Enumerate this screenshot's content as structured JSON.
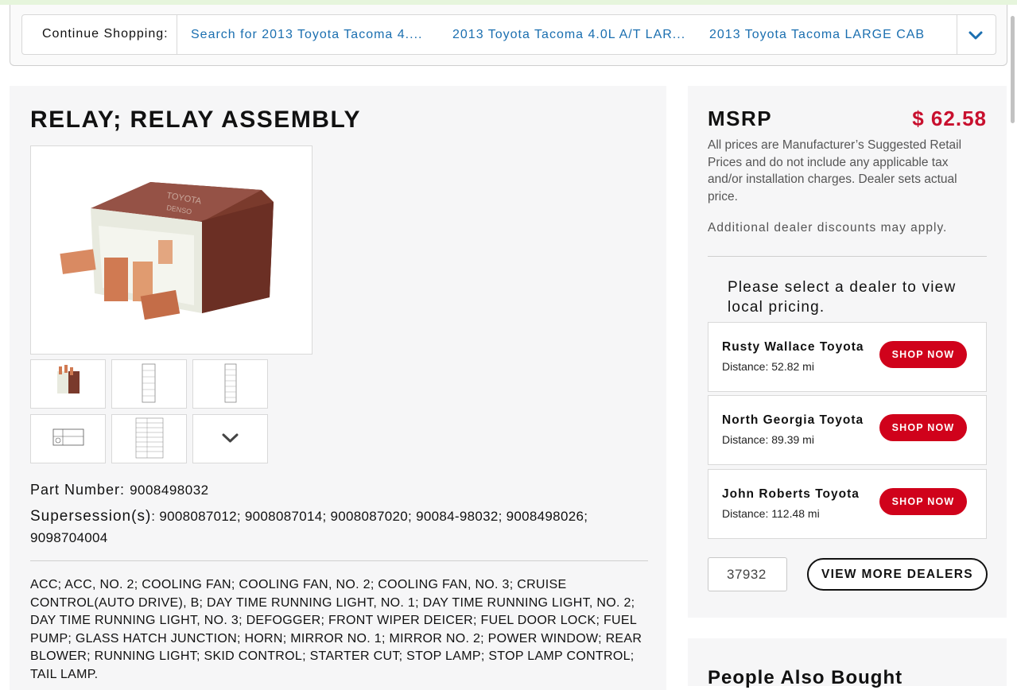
{
  "continue_shopping": {
    "label": "Continue Shopping:",
    "links": [
      "Search for 2013 Toyota Tacoma 4....",
      "2013 Toyota Tacoma 4.0L A/T LAR...",
      "2013 Toyota Tacoma LARGE CAB"
    ],
    "expand_icon": "chevron-down-icon"
  },
  "product": {
    "title": "RELAY; RELAY ASSEMBLY",
    "image_icon": "relay-photo",
    "thumbnails": [
      "relay-photo-thumb",
      "diagram-thumb",
      "diagram-thumb",
      "pnc-table-thumb",
      "parts-list-thumb"
    ],
    "more_thumbs_icon": "chevron-down-icon",
    "part_number_label": "Part Number:",
    "part_number": "9008498032",
    "supersession_label": "Supersession(s)",
    "supersessions": ": 9008087012; 9008087014; 9008087020; 90084-98032; 9008498026; 9098704004",
    "description": "ACC; ACC, NO. 2; COOLING FAN; COOLING FAN, NO. 2; COOLING FAN, NO. 3; CRUISE CONTROL(AUTO DRIVE), B; DAY TIME RUNNING LIGHT, NO. 1; DAY TIME RUNNING LIGHT, NO. 2; DAY TIME RUNNING LIGHT, NO. 3; DEFOGGER; FRONT WIPER DEICER; FUEL DOOR LOCK; FUEL PUMP; GLASS HATCH JUNCTION; HORN; MIRROR NO. 1; MIRROR NO. 2; POWER WINDOW; REAR BLOWER; RUNNING LIGHT; SKID CONTROL; STARTER CUT; STOP LAMP; STOP LAMP CONTROL; TAIL LAMP."
  },
  "pricing": {
    "msrp_label": "MSRP",
    "price": "$ 62.58",
    "price_color": "#c8102e",
    "note": "All prices are Manufacturer’s Suggested Retail Prices and do not include any applicable tax and/or installation charges. Dealer sets actual price.",
    "discount_note": "Additional dealer discounts may apply."
  },
  "dealers": {
    "prompt": "Please select a dealer to view local pricing.",
    "list": [
      {
        "name": "Rusty Wallace Toyota",
        "distance": "Distance: 52.82 mi",
        "button": "SHOP NOW"
      },
      {
        "name": "North Georgia Toyota",
        "distance": "Distance: 89.39 mi",
        "button": "SHOP NOW"
      },
      {
        "name": "John Roberts Toyota",
        "distance": "Distance: 112.48 mi",
        "button": "SHOP NOW"
      }
    ],
    "zip_value": "37932",
    "view_more_label": "VIEW MORE DEALERS",
    "button_color": "#d0021b"
  },
  "people_also_bought": {
    "title": "People Also Bought"
  }
}
